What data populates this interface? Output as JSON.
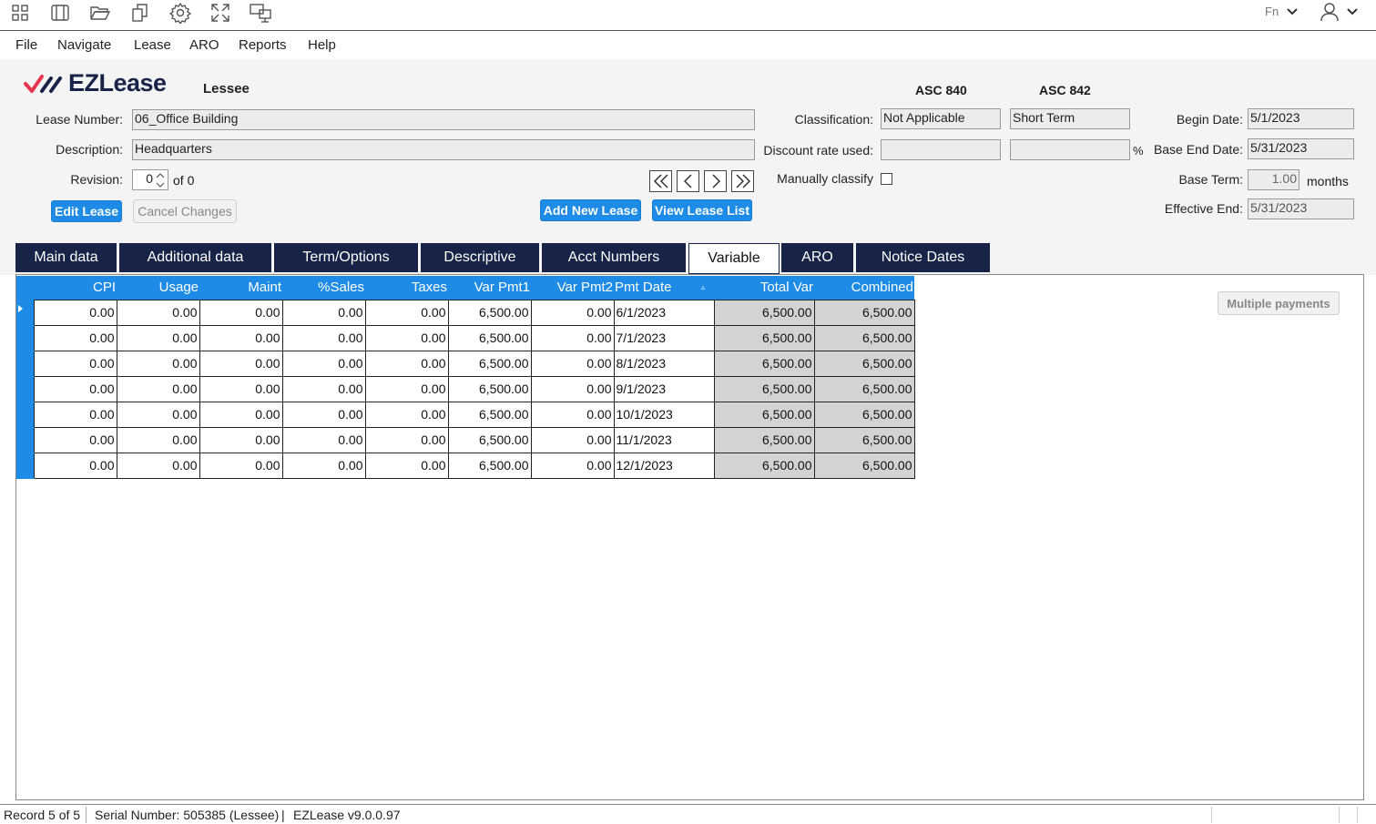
{
  "toolbar": {
    "icons": [
      "grid-icon",
      "window-icon",
      "folder-open-icon",
      "copy-icon",
      "gear-icon",
      "expand-icon",
      "remote-desktop-icon"
    ],
    "fn_label": "Fn"
  },
  "menu": [
    "File",
    "Navigate",
    "Lease",
    "ARO",
    "Reports",
    "Help"
  ],
  "brand": {
    "logo_text": "EZLease",
    "mode": "Lessee",
    "accent": "#e6364f",
    "navy": "#172448"
  },
  "form": {
    "lease_number_label": "Lease Number:",
    "lease_number": "06_Office Building",
    "description_label": "Description:",
    "description": "Headquarters",
    "revision_label": "Revision:",
    "revision_value": "0",
    "revision_of": "of 0",
    "edit_lease": "Edit Lease",
    "cancel_changes": "Cancel Changes",
    "add_new_lease": "Add New Lease",
    "view_lease_list": "View Lease List",
    "asc840": "ASC 840",
    "asc842": "ASC 842",
    "classification_label": "Classification:",
    "classification_840": "Not Applicable",
    "classification_842": "Short Term",
    "discount_label": "Discount rate used:",
    "discount_840": "",
    "discount_842": "",
    "percent": "%",
    "manually_classify_label": "Manually classify",
    "begin_date_label": "Begin Date:",
    "begin_date": "5/1/2023",
    "base_end_label": "Base End Date:",
    "base_end": "5/31/2023",
    "base_term_label": "Base Term:",
    "base_term": "1.00",
    "months": "months",
    "effective_end_label": "Effective End:",
    "effective_end": "5/31/2023"
  },
  "tabs": [
    "Main data",
    "Additional data",
    "Term/Options",
    "Descriptive",
    "Acct Numbers",
    "Variable",
    "ARO",
    "Notice Dates"
  ],
  "active_tab": "Variable",
  "grid": {
    "columns": [
      "CPI",
      "Usage",
      "Maint",
      "%Sales",
      "Taxes",
      "Var Pmt1",
      "Var Pmt2",
      "Pmt Date",
      "Total Var",
      "Combined"
    ],
    "rows": [
      [
        "0.00",
        "0.00",
        "0.00",
        "0.00",
        "0.00",
        "6,500.00",
        "0.00",
        "6/1/2023",
        "6,500.00",
        "6,500.00"
      ],
      [
        "0.00",
        "0.00",
        "0.00",
        "0.00",
        "0.00",
        "6,500.00",
        "0.00",
        "7/1/2023",
        "6,500.00",
        "6,500.00"
      ],
      [
        "0.00",
        "0.00",
        "0.00",
        "0.00",
        "0.00",
        "6,500.00",
        "0.00",
        "8/1/2023",
        "6,500.00",
        "6,500.00"
      ],
      [
        "0.00",
        "0.00",
        "0.00",
        "0.00",
        "0.00",
        "6,500.00",
        "0.00",
        "9/1/2023",
        "6,500.00",
        "6,500.00"
      ],
      [
        "0.00",
        "0.00",
        "0.00",
        "0.00",
        "0.00",
        "6,500.00",
        "0.00",
        "10/1/2023",
        "6,500.00",
        "6,500.00"
      ],
      [
        "0.00",
        "0.00",
        "0.00",
        "0.00",
        "0.00",
        "6,500.00",
        "0.00",
        "11/1/2023",
        "6,500.00",
        "6,500.00"
      ],
      [
        "0.00",
        "0.00",
        "0.00",
        "0.00",
        "0.00",
        "6,500.00",
        "0.00",
        "12/1/2023",
        "6,500.00",
        "6,500.00"
      ]
    ]
  },
  "multiple_payments": "Multiple payments",
  "status": {
    "record": "Record 5 of 5",
    "serial": "Serial Number: 505385 (Lessee)",
    "version": "EZLease v9.0.0.97"
  }
}
